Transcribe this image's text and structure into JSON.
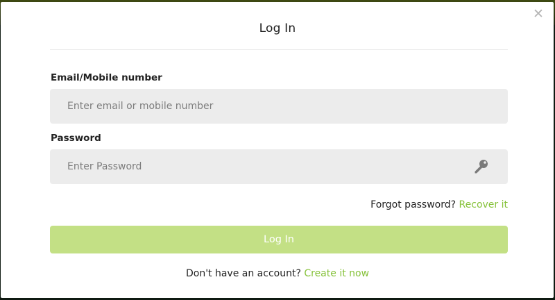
{
  "modal": {
    "title": "Log In",
    "close_icon": "close-icon"
  },
  "form": {
    "email_label": "Email/Mobile number",
    "email_placeholder": "Enter email or mobile number",
    "email_value": "",
    "password_label": "Password",
    "password_placeholder": "Enter Password",
    "password_value": "",
    "password_icon": "key-icon",
    "forgot_text": "Forgot password?",
    "forgot_link": "Recover it",
    "submit_label": "Log In",
    "signup_text": "Don't have an account?",
    "signup_link": "Create it now"
  },
  "colors": {
    "accent": "#86c23a",
    "button_disabled": "#c3e085",
    "field_bg": "#ececec"
  }
}
